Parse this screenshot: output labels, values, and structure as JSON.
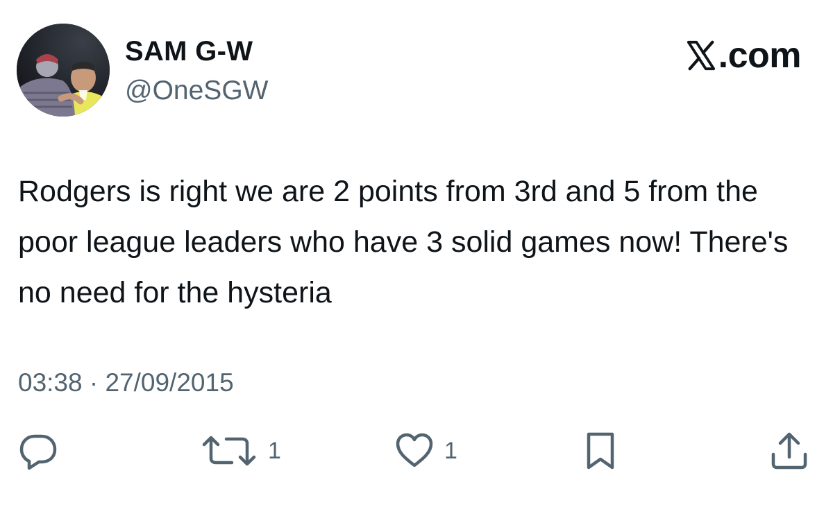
{
  "author": {
    "display_name": "SAM G-W",
    "handle": "@OneSGW"
  },
  "brand": {
    "text": ".com",
    "logo_icon": "x-logo-icon"
  },
  "tweet": {
    "text": "Rodgers is right we are 2 points from 3rd and 5 from the poor league leaders who have 3 solid games now! There's no need for the hysteria",
    "timestamp": "03:38 · 27/09/2015"
  },
  "actions": {
    "reply": {
      "icon": "reply-icon"
    },
    "retweet": {
      "icon": "retweet-icon",
      "count": "1"
    },
    "like": {
      "icon": "heart-icon",
      "count": "1"
    },
    "bookmark": {
      "icon": "bookmark-icon"
    },
    "share": {
      "icon": "share-icon"
    }
  },
  "colors": {
    "text": "#0f1419",
    "secondary": "#536471",
    "background": "#ffffff"
  }
}
